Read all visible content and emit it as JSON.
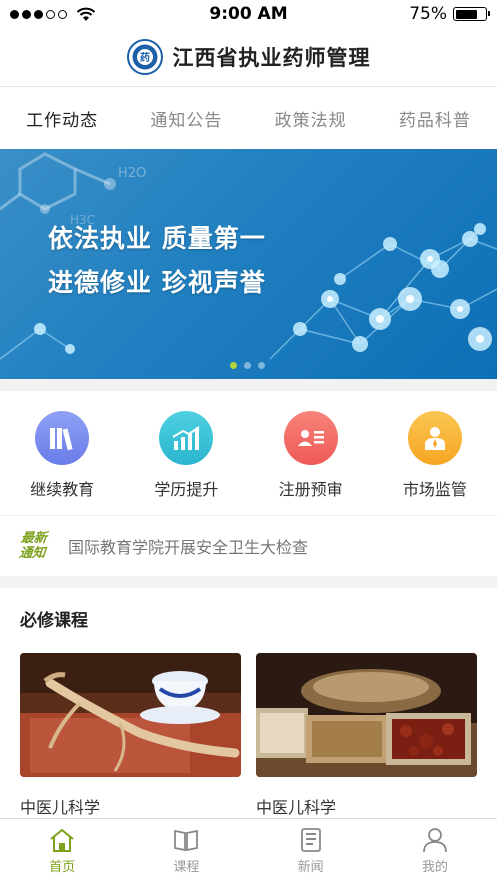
{
  "status": {
    "time": "9:00 AM",
    "battery": "75%",
    "battery_level": 0.75
  },
  "header": {
    "title": "江西省执业药师管理",
    "logo_char": "药"
  },
  "tabs": [
    {
      "label": "工作动态",
      "active": true
    },
    {
      "label": "通知公告",
      "active": false
    },
    {
      "label": "政策法规",
      "active": false
    },
    {
      "label": "药品科普",
      "active": false
    }
  ],
  "banner": {
    "line1": "依法执业 质量第一",
    "line2": "进德修业 珍视声誉",
    "label_h2o": "H2O",
    "label_h3c": "H3C",
    "page_count": 3,
    "active_page": 1
  },
  "quick": [
    {
      "label": "继续教育",
      "icon": "books-icon",
      "color": "#7b8cf0"
    },
    {
      "label": "学历提升",
      "icon": "chart-icon",
      "color": "#39c3d8"
    },
    {
      "label": "注册预审",
      "icon": "id-card-icon",
      "color": "#f2655e"
    },
    {
      "label": "市场监管",
      "icon": "inspector-icon",
      "color": "#f7b43a"
    }
  ],
  "notice": {
    "tag_line1": "最新",
    "tag_line2": "通知",
    "text": "国际教育学院开展安全卫生大检查"
  },
  "courses": {
    "heading": "必修课程",
    "items": [
      {
        "name": "中医儿科学",
        "image": "ginseng-photo"
      },
      {
        "name": "中医儿科学",
        "image": "herbs-photo"
      }
    ]
  },
  "tabbar": [
    {
      "label": "首页",
      "icon": "home-icon",
      "active": true
    },
    {
      "label": "课程",
      "icon": "book-icon",
      "active": false
    },
    {
      "label": "新闻",
      "icon": "news-icon",
      "active": false
    },
    {
      "label": "我的",
      "icon": "user-icon",
      "active": false
    }
  ],
  "colors": {
    "accent": "#7ea11e",
    "banner": "#1f7fc0"
  }
}
